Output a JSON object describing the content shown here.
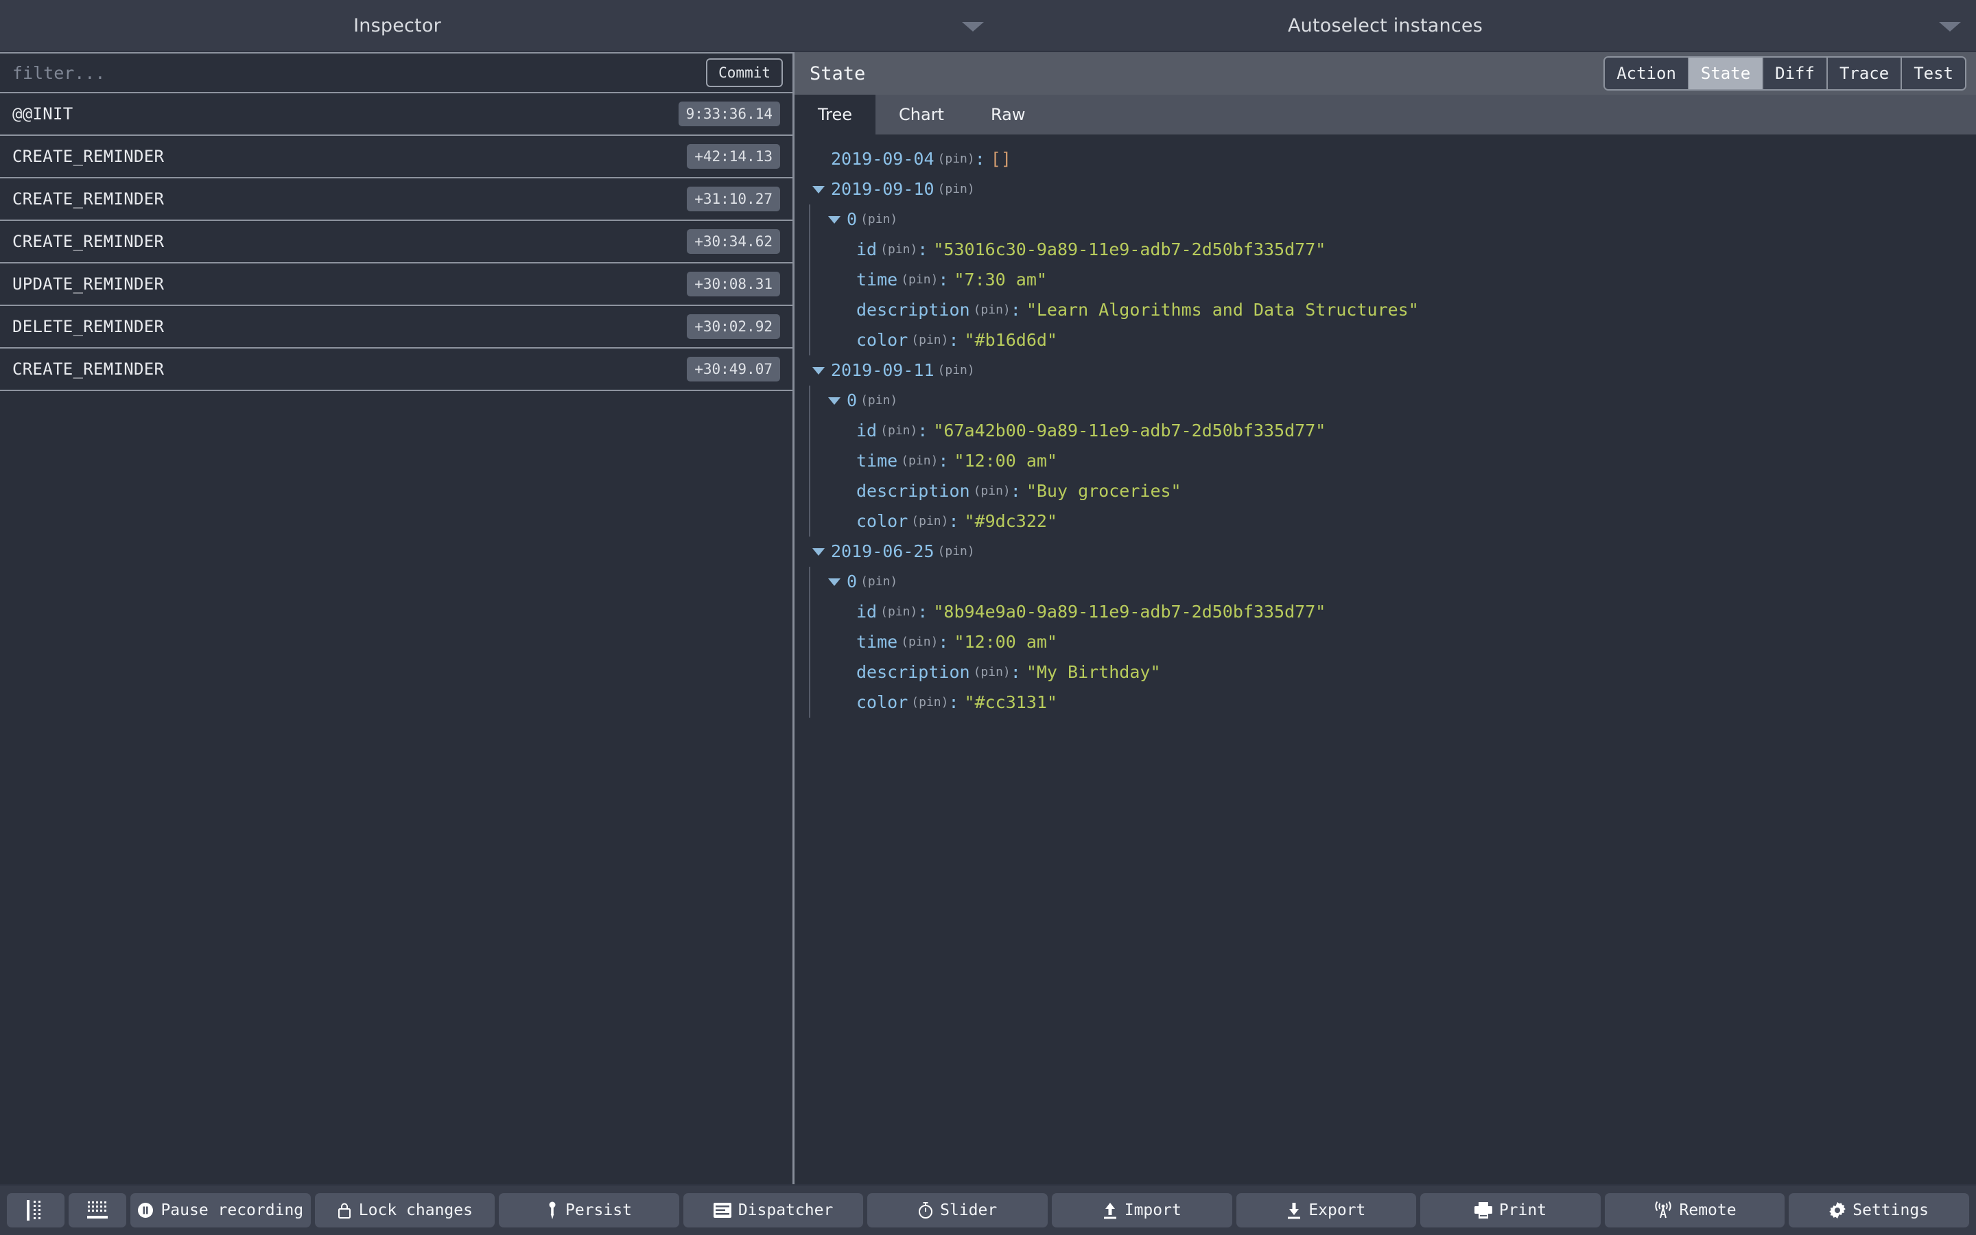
{
  "titlebar": {
    "left_title": "Inspector",
    "right_title": "Autoselect instances"
  },
  "inspector": {
    "filter_placeholder": "filter...",
    "filter_value": "",
    "commit_label": "Commit",
    "actions": [
      {
        "name": "@@INIT",
        "time": "9:33:36.14"
      },
      {
        "name": "CREATE_REMINDER",
        "time": "+42:14.13"
      },
      {
        "name": "CREATE_REMINDER",
        "time": "+31:10.27"
      },
      {
        "name": "CREATE_REMINDER",
        "time": "+30:34.62"
      },
      {
        "name": "UPDATE_REMINDER",
        "time": "+30:08.31"
      },
      {
        "name": "DELETE_REMINDER",
        "time": "+30:02.92"
      },
      {
        "name": "CREATE_REMINDER",
        "time": "+30:49.07"
      }
    ]
  },
  "monitor": {
    "header_title": "State",
    "tabs": [
      {
        "label": "Action",
        "active": false
      },
      {
        "label": "State",
        "active": true
      },
      {
        "label": "Diff",
        "active": false
      },
      {
        "label": "Trace",
        "active": false
      },
      {
        "label": "Test",
        "active": false
      }
    ],
    "subtabs": [
      {
        "label": "Tree",
        "active": true
      },
      {
        "label": "Chart",
        "active": false
      },
      {
        "label": "Raw",
        "active": false
      }
    ]
  },
  "tree": {
    "pin_label": "(pin)",
    "colon": ":",
    "empty_array": "[]",
    "index_key": "0",
    "groups": [
      {
        "date": "2019-09-04",
        "expanded": false,
        "empty": true,
        "item": null
      },
      {
        "date": "2019-09-10",
        "expanded": true,
        "empty": false,
        "item": {
          "id_key": "id",
          "id_value": "\"53016c30-9a89-11e9-adb7-2d50bf335d77\"",
          "time_key": "time",
          "time_value": "\"7:30 am\"",
          "description_key": "description",
          "description_value": "\"Learn Algorithms and Data Structures\"",
          "color_key": "color",
          "color_value": "\"#b16d6d\""
        }
      },
      {
        "date": "2019-09-11",
        "expanded": true,
        "empty": false,
        "item": {
          "id_key": "id",
          "id_value": "\"67a42b00-9a89-11e9-adb7-2d50bf335d77\"",
          "time_key": "time",
          "time_value": "\"12:00 am\"",
          "description_key": "description",
          "description_value": "\"Buy groceries\"",
          "color_key": "color",
          "color_value": "\"#9dc322\""
        }
      },
      {
        "date": "2019-06-25",
        "expanded": true,
        "empty": false,
        "item": {
          "id_key": "id",
          "id_value": "\"8b94e9a0-9a89-11e9-adb7-2d50bf335d77\"",
          "time_key": "time",
          "time_value": "\"12:00 am\"",
          "description_key": "description",
          "description_value": "\"My Birthday\"",
          "color_key": "color",
          "color_value": "\"#cc3131\""
        }
      }
    ]
  },
  "toolbar": {
    "layout_vertical_icon": "vertical-split-icon",
    "layout_horizontal_icon": "horizontal-split-icon",
    "buttons": [
      {
        "label": "Pause recording",
        "icon": "pause-icon"
      },
      {
        "label": "Lock changes",
        "icon": "lock-icon"
      },
      {
        "label": "Persist",
        "icon": "pin-icon"
      },
      {
        "label": "Dispatcher",
        "icon": "dispatcher-icon"
      },
      {
        "label": "Slider",
        "icon": "stopwatch-icon"
      },
      {
        "label": "Import",
        "icon": "upload-icon"
      },
      {
        "label": "Export",
        "icon": "download-icon"
      },
      {
        "label": "Print",
        "icon": "printer-icon"
      },
      {
        "label": "Remote",
        "icon": "broadcast-icon"
      },
      {
        "label": "Settings",
        "icon": "gear-icon"
      }
    ]
  },
  "colors": {
    "titlebar_bg": "#373c49",
    "content_bg": "#2a2f3a",
    "header_bg": "#565b66",
    "subtab_bg": "#4e535f",
    "key_color": "#8cc1e8",
    "string_color": "#b9cc5c",
    "empty_color": "#d09a6e",
    "badge_bg": "#5b6270",
    "active_tab_bg": "#a9afb9"
  }
}
